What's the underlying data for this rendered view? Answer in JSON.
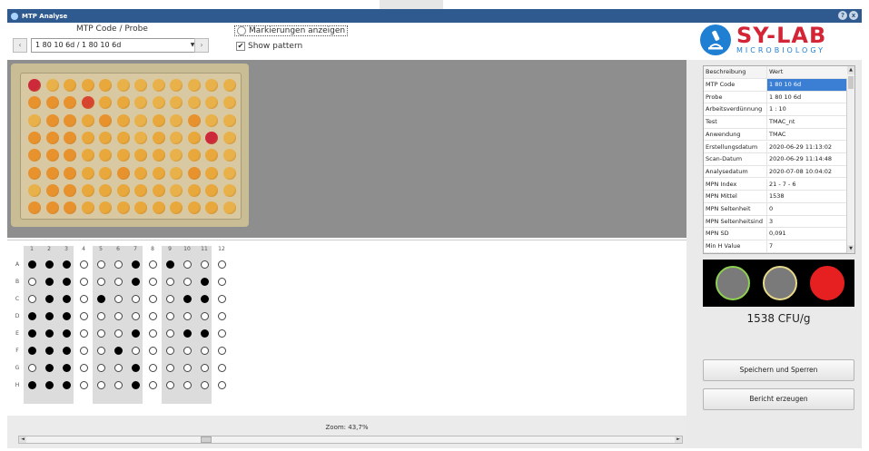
{
  "window": {
    "title": "MTP Analyse",
    "controls": [
      "?",
      "x"
    ]
  },
  "header": {
    "mtp_label": "MTP Code / Probe",
    "combo_value": "1 80 10 6d / 1 80 10 6d",
    "markierungen_label": "Markierungen anzeigen",
    "markierungen_checked": false,
    "show_pattern_label": "Show pattern",
    "show_pattern_checked": true,
    "check_mark": "✔",
    "prev_icon": "‹",
    "next_icon": "›",
    "combo_arrow": "▼"
  },
  "logo": {
    "brand": "SY-LAB",
    "sub": "MICROBIOLOGY"
  },
  "plate_wells": [
    [
      "#cc2a3a",
      "#e8b14a",
      "#e8a83c",
      "#e8a83c",
      "#e8a83c",
      "#e8b14a",
      "#e8b14a",
      "#e8b14a",
      "#e8b14a",
      "#e8b14a",
      "#e8b14a",
      "#e8b14a"
    ],
    [
      "#e8922e",
      "#e8922e",
      "#e8922e",
      "#d8452e",
      "#e8a83c",
      "#e8a83c",
      "#e8b14a",
      "#e8b14a",
      "#e8b14a",
      "#e8b14a",
      "#e8b14a",
      "#e8b14a"
    ],
    [
      "#e8b14a",
      "#e8922e",
      "#e8922e",
      "#e8a83c",
      "#e8922e",
      "#e8a83c",
      "#e8b14a",
      "#e8a83c",
      "#e8b14a",
      "#e8922e",
      "#e8b14a",
      "#e8b14a"
    ],
    [
      "#e8922e",
      "#e8922e",
      "#e8922e",
      "#e8a83c",
      "#e8a83c",
      "#e8a83c",
      "#e8b14a",
      "#e8a83c",
      "#e8b14a",
      "#e8a83c",
      "#cc2a3a",
      "#e8b14a"
    ],
    [
      "#e8922e",
      "#e8922e",
      "#e8922e",
      "#e8a83c",
      "#e8a83c",
      "#e8a83c",
      "#e8a83c",
      "#e8a83c",
      "#e8b14a",
      "#e8a83c",
      "#e8a83c",
      "#e8b14a"
    ],
    [
      "#e8922e",
      "#e8922e",
      "#e8922e",
      "#e8a83c",
      "#e8a83c",
      "#e8922e",
      "#e8a83c",
      "#e8a83c",
      "#e8b14a",
      "#e8922e",
      "#e8a83c",
      "#e8b14a"
    ],
    [
      "#e8b14a",
      "#e8922e",
      "#e8922e",
      "#e8a83c",
      "#e8a83c",
      "#e8a83c",
      "#e8a83c",
      "#e8a83c",
      "#e8b14a",
      "#e8a83c",
      "#e8a83c",
      "#e8b14a"
    ],
    [
      "#e8922e",
      "#e8922e",
      "#e8922e",
      "#e8a83c",
      "#e8a83c",
      "#e8a83c",
      "#e8a83c",
      "#e8a83c",
      "#e8a83c",
      "#e8a83c",
      "#e8a83c",
      "#e8b14a"
    ]
  ],
  "pattern": {
    "columns": [
      "1",
      "2",
      "3",
      "4",
      "5",
      "6",
      "7",
      "8",
      "9",
      "10",
      "11",
      "12"
    ],
    "rows": [
      "A",
      "B",
      "C",
      "D",
      "E",
      "F",
      "G",
      "H"
    ],
    "grid": [
      [
        1,
        1,
        1,
        0,
        0,
        0,
        1,
        0,
        1,
        0,
        0,
        0
      ],
      [
        0,
        1,
        1,
        0,
        0,
        0,
        1,
        0,
        0,
        0,
        1,
        0
      ],
      [
        0,
        1,
        1,
        0,
        1,
        0,
        0,
        0,
        0,
        1,
        1,
        0
      ],
      [
        1,
        1,
        1,
        0,
        0,
        0,
        0,
        0,
        0,
        0,
        0,
        0
      ],
      [
        1,
        1,
        1,
        0,
        0,
        0,
        1,
        0,
        0,
        1,
        1,
        0
      ],
      [
        1,
        1,
        1,
        0,
        0,
        1,
        0,
        0,
        0,
        0,
        0,
        0
      ],
      [
        0,
        1,
        1,
        0,
        0,
        0,
        1,
        0,
        0,
        0,
        0,
        0
      ],
      [
        1,
        1,
        1,
        0,
        0,
        0,
        1,
        0,
        0,
        0,
        0,
        0
      ]
    ]
  },
  "details": {
    "headers": [
      "Beschreibung",
      "Wert"
    ],
    "rows": [
      {
        "label": "MTP Code",
        "value": "1 80 10 6d",
        "selected": true
      },
      {
        "label": "Probe",
        "value": "1 80 10 6d"
      },
      {
        "label": "Arbeitsverdünnung",
        "value": "1 : 10"
      },
      {
        "label": "Test",
        "value": "TMAC_nt"
      },
      {
        "label": "Anwendung",
        "value": "TMAC"
      },
      {
        "label": "Erstellungsdatum",
        "value": "2020-06-29 11:13:02"
      },
      {
        "label": "Scan-Datum",
        "value": "2020-06-29 11:14:48"
      },
      {
        "label": "Analysedatum",
        "value": "2020-07-08 10:04:02"
      },
      {
        "label": "MPN Index",
        "value": "21 - 7 - 6"
      },
      {
        "label": "MPN Mittel",
        "value": "1538"
      },
      {
        "label": "MPN Seltenheit",
        "value": "0"
      },
      {
        "label": "MPN Seltenheitsind",
        "value": "3"
      },
      {
        "label": "MPN SD",
        "value": "0,091"
      },
      {
        "label": "Min H Value",
        "value": "7"
      }
    ],
    "scroll_up": "▲",
    "scroll_down": "▼"
  },
  "indicators": [
    {
      "fill": "#7a7a7a",
      "ring": "#8fd14f"
    },
    {
      "fill": "#7a7a7a",
      "ring": "#e6d98a"
    },
    {
      "fill": "#e62020",
      "ring": "#e62020"
    }
  ],
  "result": "1538 CFU/g",
  "buttons": {
    "save": "Speichern und Sperren",
    "report": "Bericht erzeugen"
  },
  "footer": {
    "zoom": "Zoom: 43,7%",
    "scroll_left": "◄",
    "scroll_right": "►"
  }
}
